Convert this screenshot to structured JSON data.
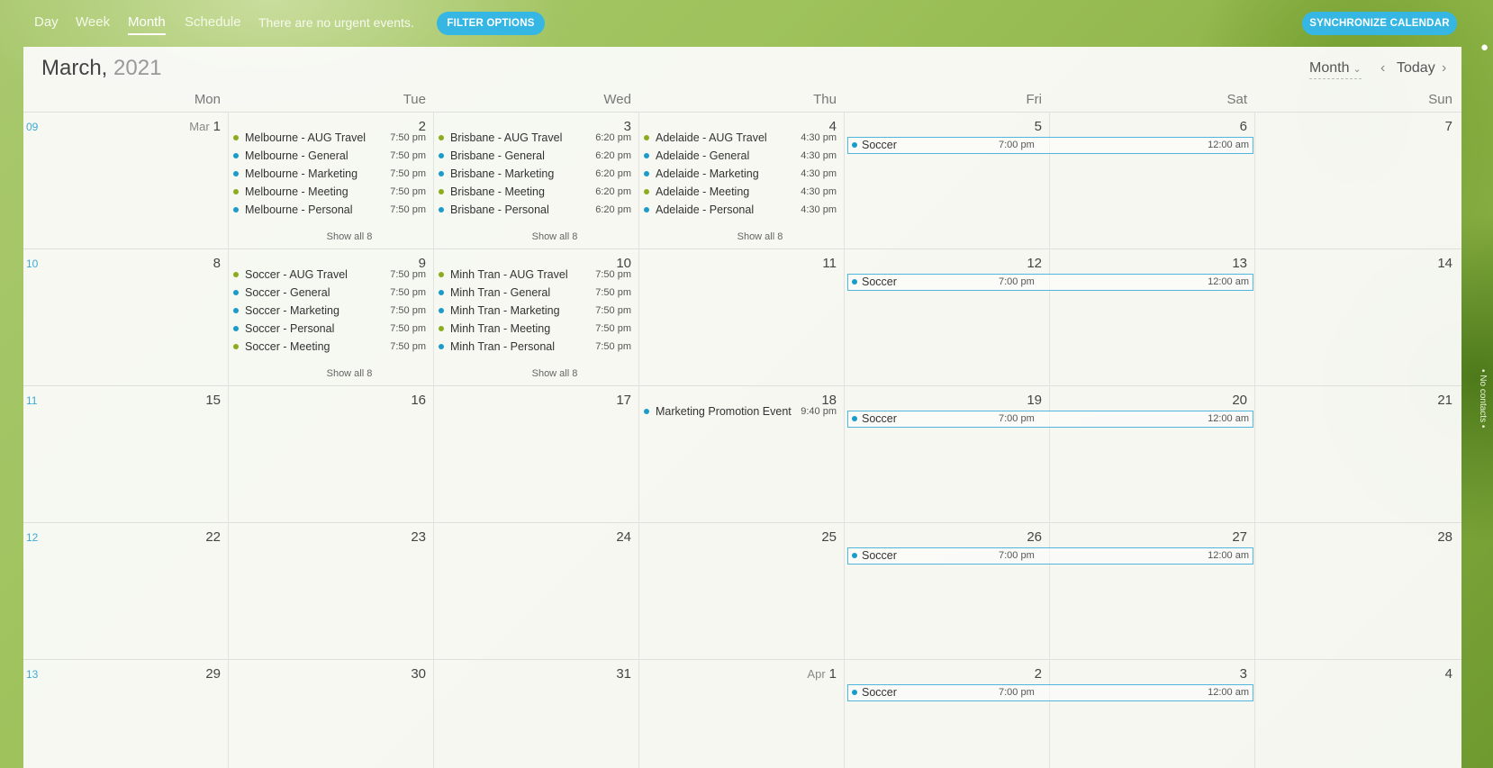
{
  "nav": {
    "day": "Day",
    "week": "Week",
    "month": "Month",
    "schedule": "Schedule",
    "urgent": "There are no urgent events.",
    "filter": "FILTER OPTIONS",
    "sync": "SYNCHRONIZE CALENDAR"
  },
  "header": {
    "month": "March,",
    "year": "2021",
    "view": "Month",
    "today": "Today"
  },
  "days_of_week": [
    "Mon",
    "Tue",
    "Wed",
    "Thu",
    "Fri",
    "Sat",
    "Sun"
  ],
  "weeks": [
    {
      "num": "09",
      "days": [
        "1",
        "2",
        "3",
        "4",
        "5",
        "6",
        "7"
      ],
      "first_prefix": "Mar"
    },
    {
      "num": "10",
      "days": [
        "8",
        "9",
        "10",
        "11",
        "12",
        "13",
        "14"
      ]
    },
    {
      "num": "11",
      "days": [
        "15",
        "16",
        "17",
        "18",
        "19",
        "20",
        "21"
      ]
    },
    {
      "num": "12",
      "days": [
        "22",
        "23",
        "24",
        "25",
        "26",
        "27",
        "28"
      ]
    },
    {
      "num": "13",
      "days": [
        "29",
        "30",
        "31",
        "1",
        "2",
        "3",
        "4"
      ],
      "apr_prefix": "Apr"
    }
  ],
  "events": {
    "w1_tue": [
      {
        "title": "Melbourne - AUG Travel",
        "time": "7:50 pm",
        "color": "#8bac1c"
      },
      {
        "title": "Melbourne - General",
        "time": "7:50 pm",
        "color": "#1a9bc9"
      },
      {
        "title": "Melbourne - Marketing",
        "time": "7:50 pm",
        "color": "#1a9bc9"
      },
      {
        "title": "Melbourne - Meeting",
        "time": "7:50 pm",
        "color": "#8bac1c"
      },
      {
        "title": "Melbourne - Personal",
        "time": "7:50 pm",
        "color": "#1a9bc9"
      }
    ],
    "w1_wed": [
      {
        "title": "Brisbane - AUG Travel",
        "time": "6:20 pm",
        "color": "#8bac1c"
      },
      {
        "title": "Brisbane - General",
        "time": "6:20 pm",
        "color": "#1a9bc9"
      },
      {
        "title": "Brisbane - Marketing",
        "time": "6:20 pm",
        "color": "#1a9bc9"
      },
      {
        "title": "Brisbane - Meeting",
        "time": "6:20 pm",
        "color": "#8bac1c"
      },
      {
        "title": "Brisbane - Personal",
        "time": "6:20 pm",
        "color": "#1a9bc9"
      }
    ],
    "w1_thu": [
      {
        "title": "Adelaide - AUG Travel",
        "time": "4:30 pm",
        "color": "#8bac1c"
      },
      {
        "title": "Adelaide - General",
        "time": "4:30 pm",
        "color": "#1a9bc9"
      },
      {
        "title": "Adelaide - Marketing",
        "time": "4:30 pm",
        "color": "#1a9bc9"
      },
      {
        "title": "Adelaide - Meeting",
        "time": "4:30 pm",
        "color": "#8bac1c"
      },
      {
        "title": "Adelaide - Personal",
        "time": "4:30 pm",
        "color": "#1a9bc9"
      }
    ],
    "w2_tue": [
      {
        "title": "Soccer - AUG Travel",
        "time": "7:50 pm",
        "color": "#8bac1c"
      },
      {
        "title": "Soccer - General",
        "time": "7:50 pm",
        "color": "#1a9bc9"
      },
      {
        "title": "Soccer - Marketing",
        "time": "7:50 pm",
        "color": "#1a9bc9"
      },
      {
        "title": "Soccer - Personal",
        "time": "7:50 pm",
        "color": "#1a9bc9"
      },
      {
        "title": "Soccer - Meeting",
        "time": "7:50 pm",
        "color": "#8bac1c"
      }
    ],
    "w2_wed": [
      {
        "title": "Minh Tran - AUG Travel",
        "time": "7:50 pm",
        "color": "#8bac1c"
      },
      {
        "title": "Minh Tran - General",
        "time": "7:50 pm",
        "color": "#1a9bc9"
      },
      {
        "title": "Minh Tran - Marketing",
        "time": "7:50 pm",
        "color": "#1a9bc9"
      },
      {
        "title": "Minh Tran - Meeting",
        "time": "7:50 pm",
        "color": "#8bac1c"
      },
      {
        "title": "Minh Tran - Personal",
        "time": "7:50 pm",
        "color": "#1a9bc9"
      }
    ],
    "w3_thu": [
      {
        "title": "Marketing Promotion Event",
        "time": "9:40 pm",
        "color": "#1a9bc9"
      }
    ]
  },
  "show_all": "Show all 8",
  "soccer": {
    "title": "Soccer",
    "start": "7:00 pm",
    "end": "12:00 am"
  },
  "side_text": "• No contacts •"
}
